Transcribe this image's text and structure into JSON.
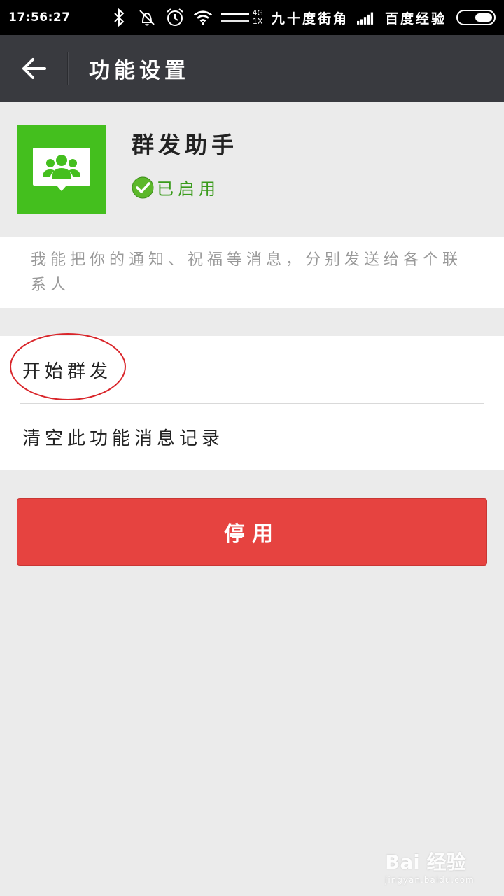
{
  "status_bar": {
    "time": "17:56:27",
    "network_top": "4G",
    "network_bottom": "1X",
    "carrier1": "九十度街角",
    "carrier2": "百度经验"
  },
  "header": {
    "title": "功能设置"
  },
  "profile": {
    "name": "群发助手",
    "status": "已启用",
    "icon_color": "#44bf1e"
  },
  "description": "我能把你的通知、祝福等消息，分别发送给各个联系人",
  "menu": {
    "items": [
      {
        "label": "开始群发"
      },
      {
        "label": "清空此功能消息记录"
      }
    ]
  },
  "disable_button": {
    "label": "停用",
    "color": "#e64340"
  },
  "watermark": {
    "logo": "Bai 经验",
    "url": "jingyan.baidu.com"
  }
}
